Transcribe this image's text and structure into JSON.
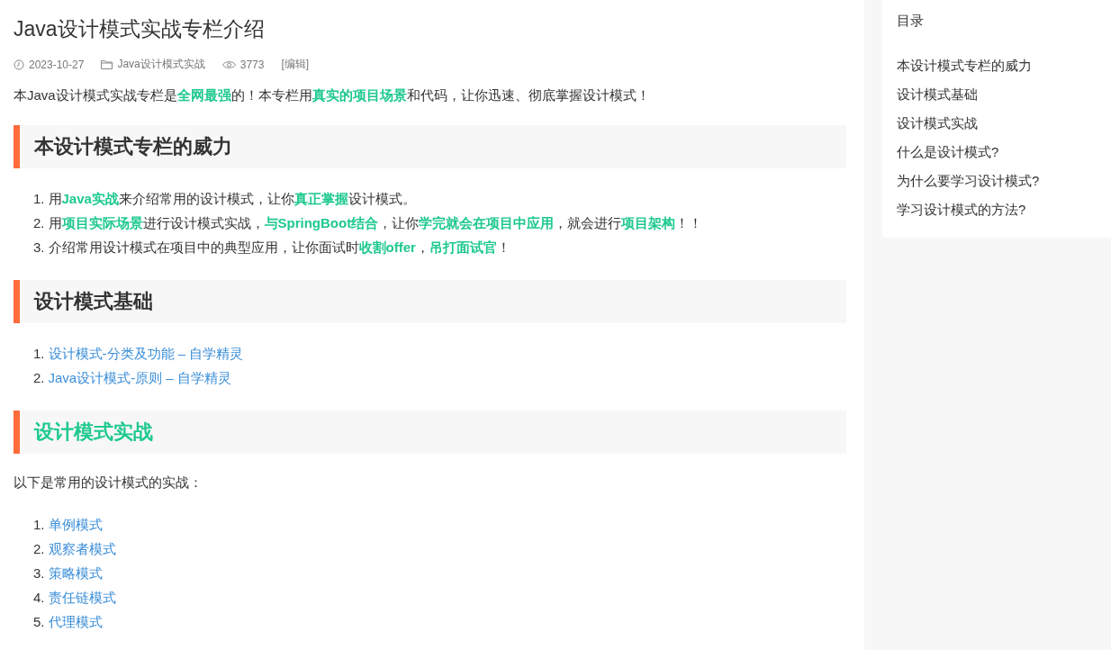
{
  "article": {
    "title": "Java设计模式实战专栏介绍",
    "meta": {
      "date": "2023-10-27",
      "category": "Java设计模式实战",
      "views": "3773",
      "edit_link": "[编辑]"
    },
    "intro": "本Java设计模式实战专栏是**全网最强**的！本专栏用**真实的项目场景**和代码，让你迅速、彻底掌握设计模式！",
    "sections": [
      {
        "heading": "本设计模式专栏的威力",
        "highlighted": false,
        "items": [
          {
            "kind": "text",
            "number": "1.",
            "text": "用**Java实战**来介绍常用的设计模式，让你**真正掌握**设计模式。"
          },
          {
            "kind": "text",
            "number": "2.",
            "text": "用**项目实际场景**进行设计模式实战，**与SpringBoot结合**，让你**学完就会在项目中应用**，就会进行**项目架构**！！"
          },
          {
            "kind": "text",
            "number": "3.",
            "text": "介绍常用设计模式在项目中的典型应用，让你面试时**收割offer**，**吊打面试官**！"
          }
        ]
      },
      {
        "heading": "设计模式基础",
        "highlighted": false,
        "items": [
          {
            "kind": "link",
            "number": "1.",
            "text": "设计模式-分类及功能 – 自学精灵"
          },
          {
            "kind": "link",
            "number": "2.",
            "text": "Java设计模式-原则 – 自学精灵"
          }
        ]
      },
      {
        "heading": "设计模式实战",
        "highlighted": true,
        "paragraph": "以下是常用的设计模式的实战：",
        "items": [
          {
            "kind": "link",
            "number": "1.",
            "text": "单例模式"
          },
          {
            "kind": "link",
            "number": "2.",
            "text": "观察者模式"
          },
          {
            "kind": "link",
            "number": "3.",
            "text": "策略模式"
          },
          {
            "kind": "link",
            "number": "4.",
            "text": "责任链模式"
          },
          {
            "kind": "link",
            "number": "5.",
            "text": "代理模式"
          }
        ]
      }
    ]
  },
  "toc": {
    "title": "目录",
    "items": [
      "本设计模式专栏的威力",
      "设计模式基础",
      "设计模式实战",
      "什么是设计模式?",
      "为什么要学习设计模式?",
      "学习设计模式的方法?"
    ]
  }
}
